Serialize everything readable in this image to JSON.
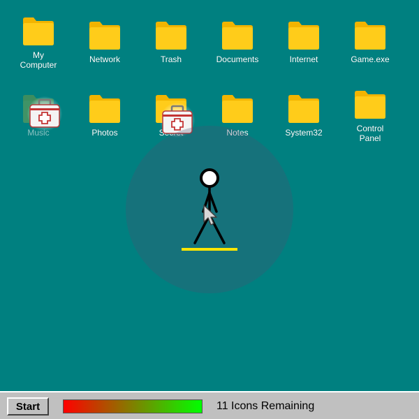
{
  "desktop": {
    "background_color": "#008080",
    "folder_color": "#FFCC00",
    "icons_row1": [
      {
        "label": "My Computer"
      },
      {
        "label": "Network"
      },
      {
        "label": "Trash"
      },
      {
        "label": "Documents"
      },
      {
        "label": "Internet"
      },
      {
        "label": "Game.exe"
      }
    ],
    "icons_row2": [
      {
        "label": "Music",
        "state": "faded"
      },
      {
        "label": "Photos"
      },
      {
        "label": "Secret"
      },
      {
        "label": "Notes"
      },
      {
        "label": "System32"
      },
      {
        "label": "Control Panel"
      }
    ]
  },
  "pickups": [
    {
      "name": "medkit",
      "icon": "first-aid-kit-icon"
    },
    {
      "name": "medkit",
      "icon": "first-aid-kit-icon"
    }
  ],
  "player": {
    "icon": "stickman-icon",
    "underline_color": "#FFE600"
  },
  "taskbar": {
    "start_label": "Start",
    "health_fraction": 1.0,
    "status_text": "11 Icons Remaining"
  }
}
